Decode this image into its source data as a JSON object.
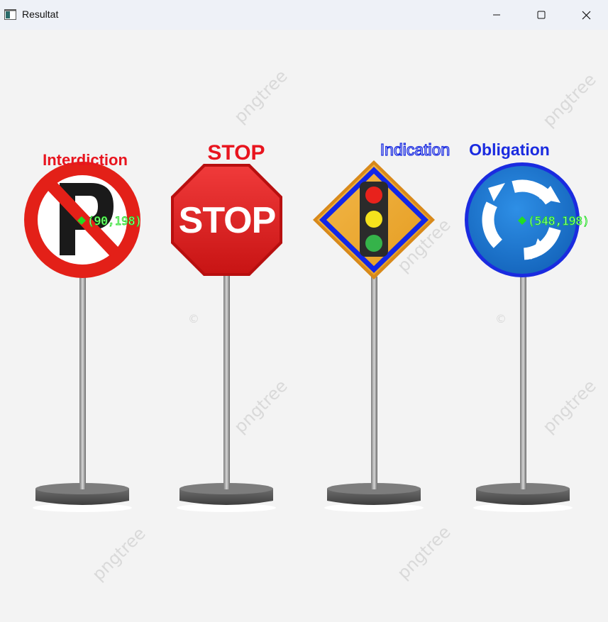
{
  "window": {
    "title": "Resultat",
    "controls": {
      "minimize": "minimize-icon",
      "maximize": "maximize-icon",
      "close": "close-icon"
    }
  },
  "labels": {
    "interdiction": "Interdiction",
    "stop": "STOP",
    "indication": "Indication",
    "obligation": "Obligation"
  },
  "sign_text": {
    "stop_face": "STOP"
  },
  "coordinates": {
    "first": "(90,198)",
    "second": "(548,198)"
  },
  "watermark": {
    "text": "pngtree",
    "symbol": "©"
  },
  "colors": {
    "label_red": "#e8141e",
    "label_blue": "#1a2be0",
    "coord_green": "#22dd22",
    "title_bar": "#eef1f7"
  }
}
